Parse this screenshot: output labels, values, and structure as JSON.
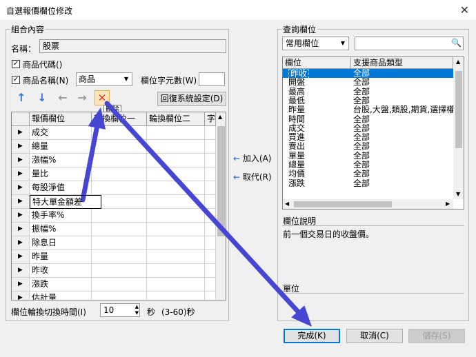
{
  "window": {
    "title": "自選報價欄位修改",
    "close_glyph": "✕"
  },
  "left_group": {
    "label": "組合內容",
    "name_label": "名稱：",
    "name_value": "股票",
    "chk_code_label": "商品代碼()",
    "chk_name_label": "商品名稱(N)",
    "chk_glyph": "✓",
    "name_select_value": "商品",
    "char_count_label": "欄位字元數(W)",
    "char_count_value": "",
    "tooltip": "刪除",
    "reset_button": "回復系統設定(D)"
  },
  "grid": {
    "columns": [
      "報價欄位",
      "輪換欄位一",
      "輪換欄位二",
      "字"
    ],
    "rows": [
      "成交",
      "總量",
      "漲幅%",
      "量比",
      "每股淨值",
      "特大單金額差",
      "換手率%",
      "振幅%",
      "除息日",
      "昨量",
      "昨收",
      "漲跌",
      "估計量"
    ],
    "editing_row": 5
  },
  "rotation": {
    "label": "欄位輪換切換時間(I)",
    "value": "10",
    "unit": "秒",
    "range": "(3-60)秒"
  },
  "middle": {
    "add_label": "加入(A)",
    "replace_label": "取代(R)"
  },
  "right_group": {
    "label": "查詢欄位",
    "category_value": "常用欄位",
    "search_value": "",
    "columns": [
      "欄位",
      "支援商品類型"
    ],
    "rows": [
      {
        "field": "昨收",
        "type": "全部"
      },
      {
        "field": "開盤",
        "type": "全部"
      },
      {
        "field": "最高",
        "type": "全部"
      },
      {
        "field": "最低",
        "type": "全部"
      },
      {
        "field": "昨量",
        "type": "台股,大盤,類股,期貨,選擇權"
      },
      {
        "field": "時間",
        "type": "全部"
      },
      {
        "field": "成交",
        "type": "全部"
      },
      {
        "field": "買進",
        "type": "全部"
      },
      {
        "field": "賣出",
        "type": "全部"
      },
      {
        "field": "單量",
        "type": "全部"
      },
      {
        "field": "總量",
        "type": "全部"
      },
      {
        "field": "均價",
        "type": "全部"
      },
      {
        "field": "漲跌",
        "type": "全部"
      }
    ],
    "desc_label": "欄位說明",
    "desc_text": "前一個交易日的收盤價。",
    "unit_label": "單位",
    "unit_text": ""
  },
  "footer": {
    "ok": "完成(K)",
    "cancel": "取消(C)",
    "save": "儲存(S)"
  },
  "colors": {
    "arrow": "#4646d2",
    "selection": "#0078d7",
    "up_down": "#3a78d4",
    "delete": "#e03030"
  },
  "icons": {
    "up": "↑",
    "down": "↓",
    "left": "←",
    "right": "→",
    "delete": "✕",
    "search": "🔍",
    "dropdown": "▼",
    "row_pointer": "▶"
  }
}
